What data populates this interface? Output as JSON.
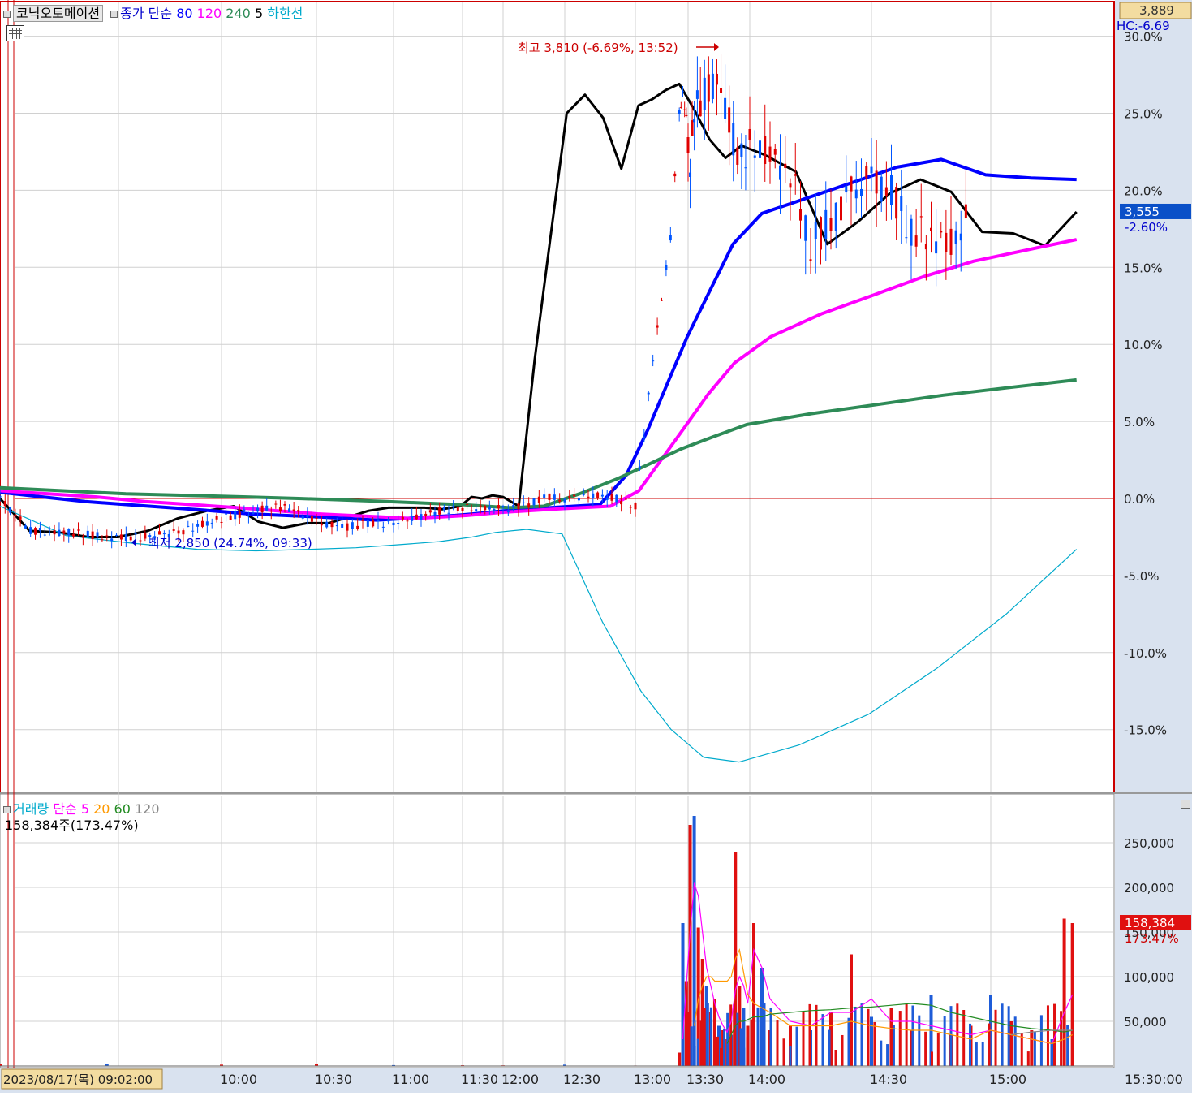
{
  "header": {
    "stock_name": "코닉오토메이션",
    "indicator_label": "종가 단순",
    "ma_periods": [
      "80",
      "120",
      "240"
    ],
    "ma_colors": [
      "#0000ff",
      "#ff00ff",
      "#2e8b57"
    ],
    "extra_label": "5",
    "lower_line_label": "하한선",
    "lower_line_color": "#00aacc"
  },
  "price_box": {
    "current": "3,889",
    "hc_label": "HC:-6.69"
  },
  "price_marker": {
    "value": "3,555",
    "pct": "-2.60%"
  },
  "volume_header": {
    "title": "거래량",
    "indicator_label": "단순",
    "ma_periods": [
      "5",
      "20",
      "60",
      "120"
    ],
    "ma_colors": [
      "#ff00ff",
      "#ff9900",
      "#228b22",
      "#888888"
    ],
    "current_text": "158,384주(173.47%)"
  },
  "volume_marker": {
    "value": "158,384",
    "pct": "173.47%"
  },
  "annotations": {
    "high": "최고 3,810 (-6.69%, 13:52)",
    "low": "최저 2,850 (24.74%, 09:33)"
  },
  "x_axis": {
    "start_date": "2023/08/17(목) 09:02:00",
    "ticks": [
      "10:00",
      "10:30",
      "11:00",
      "11:30",
      "12:00",
      "12:30",
      "13:00",
      "13:30",
      "14:00",
      "14:30",
      "15:00"
    ],
    "end": "15:30:00"
  },
  "chart_data": [
    {
      "type": "line",
      "title": "코닉오토메이션",
      "y_axis_ticks": [
        "30.0%",
        "25.0%",
        "20.0%",
        "15.0%",
        "10.0%",
        "5.0%",
        "0.0%",
        "-5.0%",
        "-10.0%",
        "-15.0%"
      ],
      "ylim": [
        -18,
        30
      ],
      "x": [
        "09:02",
        "09:10",
        "09:20",
        "09:30",
        "09:40",
        "09:50",
        "10:00",
        "10:10",
        "10:20",
        "10:30",
        "10:40",
        "10:50",
        "11:00",
        "11:10",
        "11:20",
        "11:30",
        "11:40",
        "11:50",
        "12:00",
        "12:10",
        "12:20",
        "12:30",
        "12:40",
        "12:50",
        "13:00",
        "13:10",
        "13:20",
        "13:25",
        "13:27",
        "13:29",
        "13:31",
        "13:33",
        "13:36",
        "13:40",
        "13:44",
        "13:48",
        "13:52",
        "13:56",
        "14:00",
        "14:05",
        "14:10",
        "14:15",
        "14:20",
        "14:25",
        "14:30",
        "14:35",
        "14:40",
        "14:45",
        "14:50",
        "14:55",
        "15:00",
        "15:05",
        "15:10",
        "15:15",
        "15:20"
      ],
      "series": [
        {
          "name": "종가",
          "color": "#000000",
          "values": [
            0,
            -2.1,
            -2.2,
            -2.5,
            -2.5,
            -2.1,
            -1.3,
            -0.8,
            -0.5,
            -1.5,
            -1.9,
            -1.6,
            -1.6,
            -1.2,
            -0.8,
            -0.6,
            -0.6,
            -0.6,
            -0.7,
            -0.5,
            0.1,
            0,
            0.2,
            0.1,
            -0.5,
            9,
            17,
            25,
            26.2,
            24.7,
            21.4,
            25.5,
            25.9,
            26.5,
            26.9,
            25.3,
            23.3,
            22.1,
            22.9,
            22.3,
            21.2,
            16.5,
            18,
            19.8,
            20.7,
            19.9,
            17.3,
            17.2,
            16.4,
            18.6
          ]
        },
        {
          "name": "80",
          "color": "#0000ff",
          "values": [
            0.4,
            0.1,
            -0.2,
            -0.4,
            -0.6,
            -0.8,
            -1.0,
            -1.1,
            -1.2,
            -1.3,
            -1.4,
            -1.3,
            -1.2,
            -1.1,
            -1.0,
            -0.9,
            -0.8,
            -0.7,
            -0.6,
            -0.5,
            -0.4,
            1.5,
            4.5,
            7.5,
            10.5,
            13.5,
            16.5,
            18.5,
            19.5,
            20.5,
            21.5,
            22,
            21,
            20.8,
            20.7
          ]
        },
        {
          "name": "120",
          "color": "#ff00ff",
          "values": [
            0.5,
            0.3,
            0.1,
            -0.2,
            -0.4,
            -0.6,
            -0.8,
            -1.0,
            -1.1,
            -1.2,
            -1.3,
            -1.2,
            -1.1,
            -1.0,
            -0.9,
            -0.8,
            -0.7,
            -0.6,
            -0.5,
            0.5,
            2.5,
            4.5,
            6.8,
            8.8,
            10.5,
            12,
            13.2,
            14.4,
            15.4,
            16.1,
            16.8
          ]
        },
        {
          "name": "240",
          "color": "#2e8b57",
          "values": [
            0.7,
            0.5,
            0.3,
            0.2,
            0.1,
            0,
            -0.1,
            -0.2,
            -0.3,
            -0.4,
            -0.5,
            -0.6,
            -0.5,
            0.3,
            1.3,
            2.3,
            3.2,
            4.0,
            4.8,
            5.5,
            6.1,
            6.7,
            7.2,
            7.7
          ]
        },
        {
          "name": "하한선",
          "color": "#00aacc",
          "values": [
            -0.5,
            -2.4,
            -2.9,
            -3.3,
            -3.4,
            -3.3,
            -3.2,
            -3.0,
            -2.8,
            -2.5,
            -2.2,
            -2.0,
            -2.3,
            -8,
            -12.5,
            -15,
            -16.8,
            -17.1,
            -16,
            -14,
            -11,
            -7.5,
            -3.3
          ]
        }
      ]
    },
    {
      "type": "bar",
      "title": "거래량",
      "y_axis_ticks": [
        "250,000",
        "200,000",
        "150,000",
        "100,000",
        "50,000"
      ],
      "ylim": [
        0,
        290000
      ],
      "categories": [
        "09:02",
        "09:30",
        "10:00",
        "10:30",
        "11:00",
        "11:30",
        "12:00",
        "12:30",
        "13:00",
        "13:25",
        "13:27",
        "13:29",
        "13:31",
        "13:33",
        "13:35",
        "13:37",
        "13:39",
        "13:41",
        "13:43",
        "13:45",
        "13:47",
        "13:49",
        "13:51",
        "13:53",
        "13:55",
        "13:57",
        "13:59",
        "14:01",
        "14:03",
        "14:05",
        "14:10",
        "14:15",
        "14:20",
        "14:25",
        "14:30",
        "14:35",
        "14:40",
        "14:45",
        "14:50",
        "14:55",
        "15:00",
        "15:05",
        "15:10",
        "15:15",
        "15:18",
        "15:20"
      ],
      "series": [
        {
          "name": "거래량",
          "values": [
            2000,
            2500,
            1500,
            2000,
            1000,
            800,
            700,
            1500,
            500,
            15000,
            160000,
            95000,
            270000,
            280000,
            155000,
            120000,
            90000,
            60000,
            75000,
            45000,
            40000,
            30000,
            35000,
            240000,
            90000,
            65000,
            45000,
            160000,
            110000,
            40000,
            45000,
            40000,
            60000,
            125000,
            55000,
            65000,
            40000,
            80000,
            35000,
            45000,
            80000,
            50000,
            40000,
            30000,
            165000,
            160000
          ]
        },
        {
          "name": "5",
          "color": "#ff00ff",
          "values": [
            null,
            null,
            null,
            null,
            null,
            null,
            null,
            null,
            null,
            null,
            30000,
            90000,
            150000,
            205000,
            190000,
            150000,
            110000,
            90000,
            70000,
            55000,
            45000,
            38000,
            50000,
            85000,
            100000,
            90000,
            70000,
            130000,
            110000,
            75000,
            50000,
            45000,
            60000,
            60000,
            75000,
            50000,
            50000,
            45000,
            40000,
            35000,
            40000,
            35000,
            30000,
            25000,
            60000,
            80000
          ]
        },
        {
          "name": "20",
          "color": "#ff9900",
          "values": [
            null,
            null,
            null,
            null,
            null,
            null,
            null,
            null,
            null,
            null,
            null,
            null,
            null,
            45000,
            75000,
            90000,
            100000,
            100000,
            95000,
            95000,
            95000,
            95000,
            100000,
            120000,
            130000,
            105000,
            80000,
            70000,
            65000,
            60000,
            45000,
            45000,
            45000,
            50000,
            45000,
            42000,
            40000,
            40000,
            35000,
            30000,
            40000,
            35000,
            30000,
            25000,
            30000,
            35000
          ]
        },
        {
          "name": "60",
          "color": "#228b22",
          "values": [
            null,
            null,
            null,
            null,
            null,
            null,
            null,
            null,
            null,
            null,
            null,
            null,
            null,
            null,
            null,
            null,
            null,
            null,
            null,
            null,
            null,
            25000,
            35000,
            45000,
            50000,
            50000,
            52000,
            55000,
            55000,
            58000,
            60000,
            62000,
            63000,
            65000,
            66000,
            68000,
            70000,
            68000,
            60000,
            55000,
            50000,
            45000,
            42000,
            40000,
            38000,
            40000
          ]
        },
        {
          "name": "120",
          "color": "#888888",
          "values": [
            null,
            null,
            null,
            null,
            null,
            null,
            null,
            null,
            null,
            null,
            null,
            null,
            null,
            null,
            null,
            null,
            null,
            null,
            null,
            null,
            null,
            null,
            null,
            null,
            null,
            null,
            null,
            null,
            null,
            null,
            null,
            null,
            null,
            null,
            null,
            null,
            null,
            null,
            null,
            null,
            null,
            35000,
            38000,
            40000,
            40000,
            40000
          ]
        }
      ]
    }
  ]
}
